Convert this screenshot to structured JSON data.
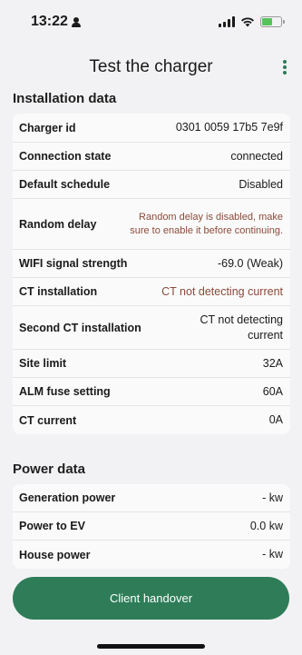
{
  "status_bar": {
    "time": "13:22"
  },
  "header": {
    "title": "Test the charger"
  },
  "installation": {
    "title": "Installation data",
    "rows": [
      {
        "label": "Charger id",
        "value": "0301 0059 17b5 7e9f"
      },
      {
        "label": "Connection state",
        "value": "connected"
      },
      {
        "label": "Default schedule",
        "value": "Disabled"
      },
      {
        "label": "Random delay",
        "value": "Random delay is disabled, make sure to enable it before continuing."
      },
      {
        "label": "WIFI signal strength",
        "value": "-69.0 (Weak)"
      },
      {
        "label": "CT installation",
        "value": "CT not detecting current"
      },
      {
        "label": "Second CT installation",
        "value": "CT not detecting current"
      },
      {
        "label": "Site limit",
        "value": "32A"
      },
      {
        "label": "ALM fuse setting",
        "value": "60A"
      },
      {
        "label": "CT current",
        "value": "0A"
      }
    ]
  },
  "power": {
    "title": "Power data",
    "rows": [
      {
        "label": "Generation power",
        "value": "- kw"
      },
      {
        "label": "Power to EV",
        "value": "0.0 kw"
      },
      {
        "label": "House power",
        "value": "- kw"
      }
    ]
  },
  "footer": {
    "button_label": "Client handover"
  },
  "colors": {
    "accent": "#2e7d58",
    "warning_text": "#8a4b3a",
    "background": "#f2f2f4"
  }
}
